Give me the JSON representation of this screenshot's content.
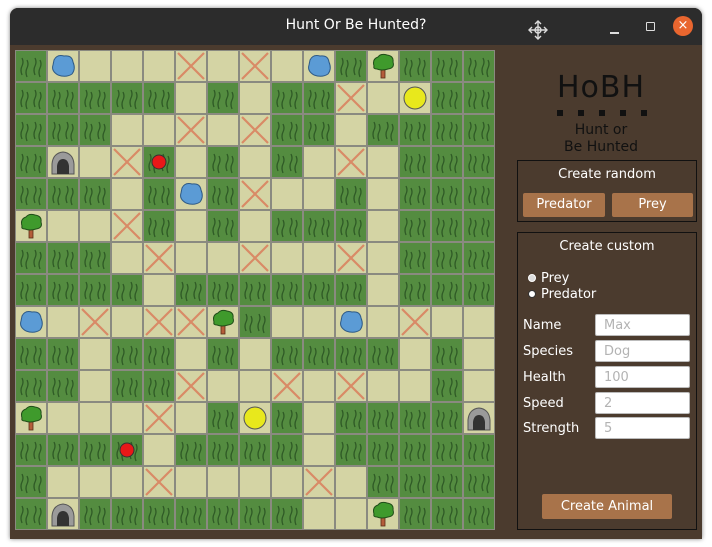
{
  "window": {
    "title": "Hunt Or Be Hunted?",
    "close_glyph": "×",
    "move_icon": "move-icon"
  },
  "board": {
    "columns": 15,
    "rows": 15,
    "colors": {
      "grass": "#548c40",
      "path": "#d4d4a4",
      "grid_line": "#8a8a80",
      "cross": "#d98a66",
      "predator": "#e81818",
      "prey": "#e8e81c",
      "water": "#5b9bd5",
      "tree_leaves": "#3f9a2c",
      "tree_trunk": "#b45d3a",
      "cave": "#9a9a9a"
    },
    "legend": "G = grass, P = path, X = blocked path, W = water, T = tree, C = cave, R = predator (red dot), Y = prey (yellow dot)",
    "grid": [
      "GWPPPXPXPWGTGGG",
      "GGGGGPGPGGXPYGG",
      "GGGPPXPXGGPGGGG",
      "GCPXRPGPGPXPGGG",
      "GGGPGWGXPPGPGGG",
      "TPPXGPGPGGGPGGG",
      "GGGPXPPXPPXPGGG",
      "GGGGPGGGGGGPGGG",
      "WPXPXXTGPPWPXPP",
      "GGPGGPGPGGGGPGP",
      "GGPGGXPPXPXPPGP",
      "TPPPXPGYGPGGGGC",
      "GGGRPGGGGPGGGGG",
      "GPPPXPPPPXPGGGG",
      "GCGGGGGGGPPTGGG"
    ]
  },
  "sidebar": {
    "logo": {
      "title": "HoBH",
      "subtitle_line1": "Hunt or",
      "subtitle_line2": "Be Hunted"
    },
    "random_panel": {
      "title": "Create random",
      "predator_button": "Predator",
      "prey_button": "Prey"
    },
    "custom_panel": {
      "title": "Create custom",
      "radio_prey": "Prey",
      "radio_predator": "Predator",
      "selected": "Predator",
      "fields": [
        {
          "label": "Name",
          "placeholder": "Max"
        },
        {
          "label": "Species",
          "placeholder": "Dog"
        },
        {
          "label": "Health",
          "placeholder": "100"
        },
        {
          "label": "Speed",
          "placeholder": "2"
        },
        {
          "label": "Strength",
          "placeholder": "5"
        }
      ],
      "create_button": "Create Animal"
    },
    "colors": {
      "background": "#4b3b2e",
      "button": "#a8734a",
      "text": "#ffffff"
    }
  }
}
